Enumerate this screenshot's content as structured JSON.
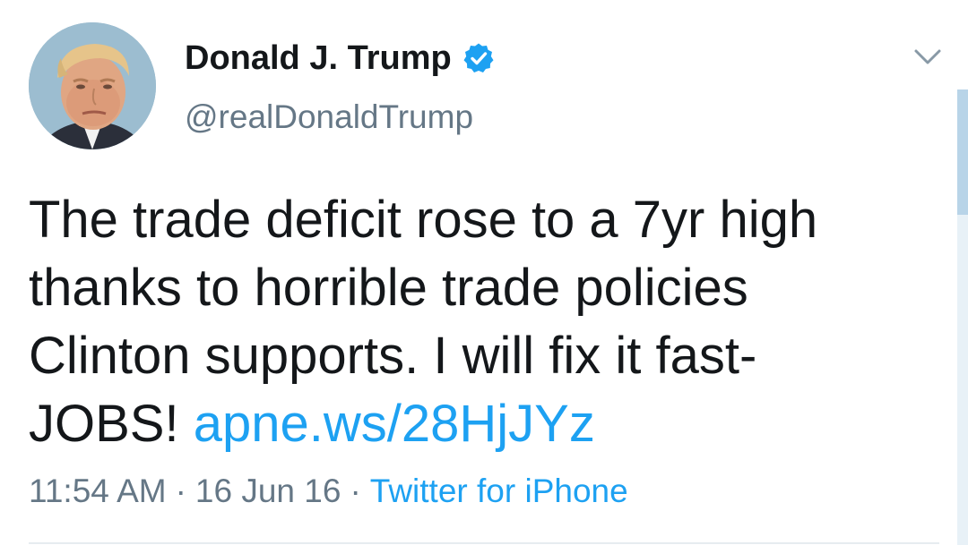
{
  "tweet": {
    "display_name": "Donald J. Trump",
    "handle": "@realDonaldTrump",
    "verified": true,
    "text_lines": [
      "The trade deficit rose to a 7yr high",
      "thanks to horrible trade policies",
      "Clinton supports. I will fix it fast-"
    ],
    "text_last_prefix": "JOBS! ",
    "link": "apne.ws/28HjJYz",
    "time": "11:54 AM",
    "separator": "·",
    "date": "16 Jun 16",
    "source": "Twitter for iPhone"
  },
  "icons": {
    "verified": "verified-badge-icon",
    "menu": "chevron-down-icon"
  },
  "colors": {
    "text": "#14171a",
    "secondary": "#657786",
    "link": "#1da1f2",
    "verified": "#1da1f2",
    "divider": "#e6ecf0"
  }
}
